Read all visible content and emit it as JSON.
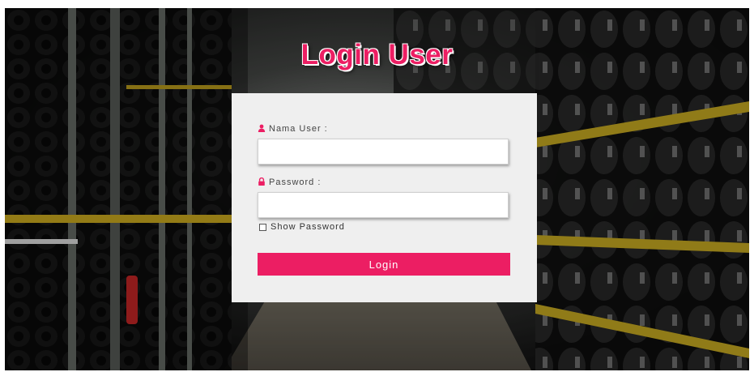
{
  "page": {
    "title": "Login User"
  },
  "form": {
    "username_label": "Nama User :",
    "username_value": "",
    "password_label": "Password :",
    "password_value": "",
    "show_password_label": "Show Password",
    "show_password_checked": false,
    "login_label": "Login"
  },
  "icons": {
    "user": "user-icon",
    "lock": "lock-icon"
  },
  "colors": {
    "accent": "#ec1e63",
    "card": "#efefef"
  }
}
